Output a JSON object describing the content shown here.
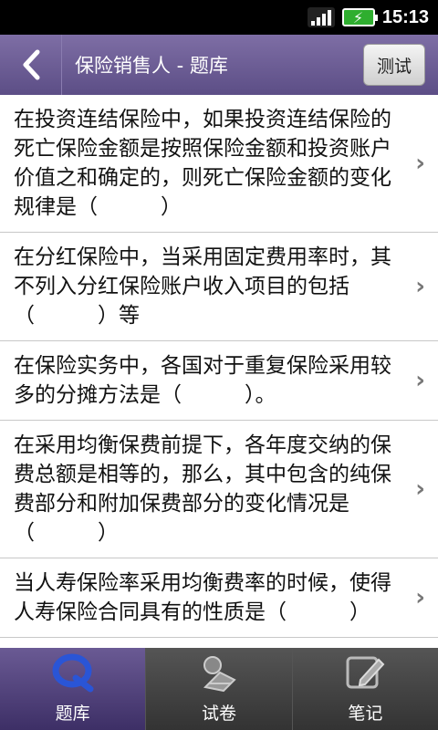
{
  "status_bar": {
    "time": "15:13"
  },
  "header": {
    "back_icon": "back-chevron-icon",
    "title": "保险销售人 - 题库",
    "test_button_label": "测试"
  },
  "questions": [
    {
      "text": "在投资连结保险中，如果投资连结保险的死亡保险金额是按照保险金额和投资账户价值之和确定的，则死亡保险金额的变化规律是（　　　）"
    },
    {
      "text": "在分红保险中，当采用固定费用率时，其不列入分红保险账户收入项目的包括（　　　）等"
    },
    {
      "text": "在保险实务中，各国对于重复保险采用较多的分摊方法是（　　　）。"
    },
    {
      "text": "在采用均衡保费前提下，各年度交纳的保费总额是相等的，那么，其中包含的纯保费部分和附加保费部分的变化情况是（　　　）"
    },
    {
      "text": "当人寿保险率采用均衡费率的时候，使得人寿保险合同具有的性质是（　　　）"
    }
  ],
  "tabs": [
    {
      "label": "题库",
      "icon": "question-bank-icon",
      "active": true
    },
    {
      "label": "试卷",
      "icon": "exam-paper-icon",
      "active": false
    },
    {
      "label": "笔记",
      "icon": "notes-icon",
      "active": false
    }
  ],
  "colors": {
    "header_bg": "#6d5e98",
    "active_tab": "#5a4a88"
  }
}
